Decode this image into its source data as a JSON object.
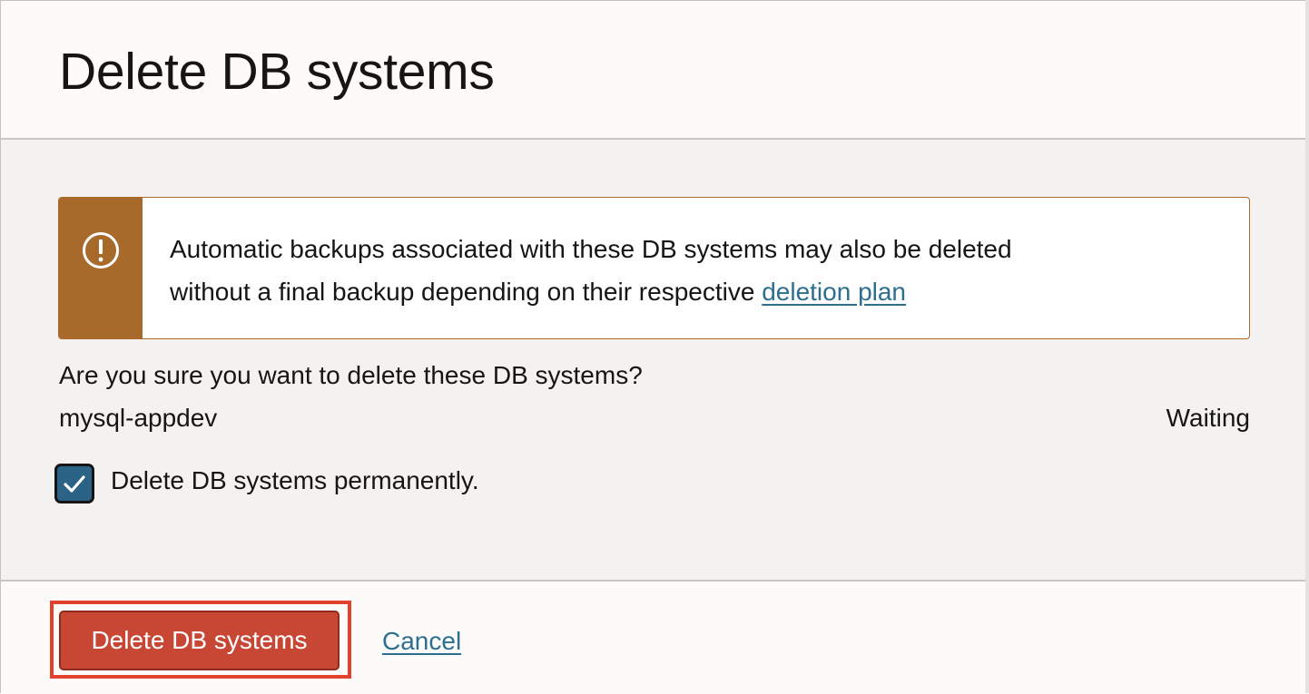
{
  "dialog": {
    "title": "Delete DB systems"
  },
  "warning": {
    "icon": "exclamation-circle-icon",
    "text_line1": "Automatic backups associated with these DB systems may also be deleted",
    "text_line2": "without a final backup depending on their respective ",
    "link_text": "deletion plan",
    "stripe_color": "#a86a2b"
  },
  "confirmation": {
    "question": "Are you sure you want to delete these DB systems?",
    "systems": [
      {
        "name": "mysql-appdev",
        "status": "Waiting"
      }
    ],
    "permanent_checkbox": {
      "label": "Delete DB systems permanently.",
      "checked": true
    }
  },
  "footer": {
    "delete_label": "Delete DB systems",
    "cancel_label": "Cancel",
    "delete_color": "#c74634",
    "highlight_color": "#e2412e"
  }
}
